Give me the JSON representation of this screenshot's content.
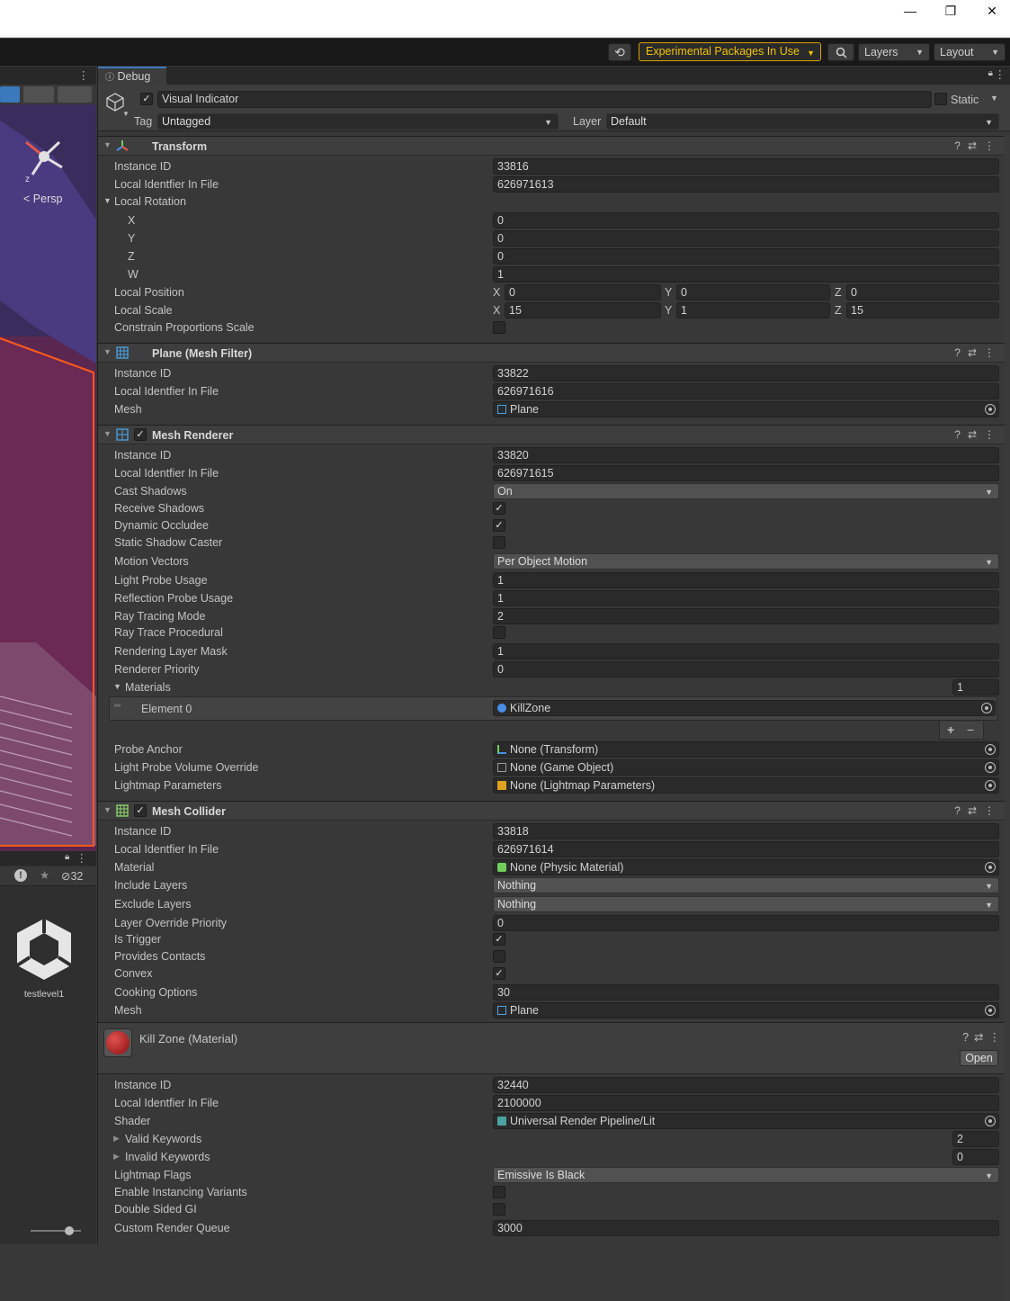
{
  "window": {
    "minimize": "—",
    "restore": "❐",
    "close": "✕"
  },
  "toolbar": {
    "experimental_label": "Experimental Packages In Use",
    "layers_label": "Layers",
    "layout_label": "Layout"
  },
  "scene": {
    "persp_label": "Persp",
    "axis_label": "z",
    "hidden_count": "32"
  },
  "project": {
    "asset_name": "testlevel1"
  },
  "inspector": {
    "tab_label": "Debug",
    "object_name": "Visual Indicator",
    "static_label": "Static",
    "tag_label": "Tag",
    "tag_value": "Untagged",
    "layer_label": "Layer",
    "layer_value": "Default",
    "transform": {
      "title": "Transform",
      "instance_id_label": "Instance ID",
      "instance_id": "33816",
      "local_id_label": "Local Identfier In File",
      "local_id": "626971613",
      "local_rotation_label": "Local Rotation",
      "x_label": "X",
      "x": "0",
      "y_label": "Y",
      "y": "0",
      "z_label": "Z",
      "z": "0",
      "w_label": "W",
      "w": "1",
      "local_position_label": "Local Position",
      "pos_x": "0",
      "pos_y": "0",
      "pos_z": "0",
      "local_scale_label": "Local Scale",
      "scale_x": "15",
      "scale_y": "1",
      "scale_z": "15",
      "constrain_label": "Constrain Proportions Scale"
    },
    "mesh_filter": {
      "title": "Plane (Mesh Filter)",
      "instance_id_label": "Instance ID",
      "instance_id": "33822",
      "local_id_label": "Local Identfier In File",
      "local_id": "626971616",
      "mesh_label": "Mesh",
      "mesh": "Plane"
    },
    "mesh_renderer": {
      "title": "Mesh Renderer",
      "instance_id_label": "Instance ID",
      "instance_id": "33820",
      "local_id_label": "Local Identfier In File",
      "local_id": "626971615",
      "cast_shadows_label": "Cast Shadows",
      "cast_shadows": "On",
      "receive_shadows_label": "Receive Shadows",
      "dynamic_occludee_label": "Dynamic Occludee",
      "static_shadow_label": "Static Shadow Caster",
      "motion_vectors_label": "Motion Vectors",
      "motion_vectors": "Per Object Motion",
      "light_probe_label": "Light Probe Usage",
      "light_probe": "1",
      "reflection_probe_label": "Reflection Probe Usage",
      "reflection_probe": "1",
      "ray_tracing_label": "Ray Tracing Mode",
      "ray_tracing": "2",
      "ray_trace_proc_label": "Ray Trace Procedural",
      "layer_mask_label": "Rendering Layer Mask",
      "layer_mask": "1",
      "priority_label": "Renderer Priority",
      "priority": "0",
      "materials_label": "Materials",
      "materials_count": "1",
      "element0_label": "Element 0",
      "element0": "KillZone",
      "add": "+",
      "remove": "−",
      "probe_anchor_label": "Probe Anchor",
      "probe_anchor": "None (Transform)",
      "lpvo_label": "Light Probe Volume Override",
      "lpvo": "None (Game Object)",
      "lightmap_params_label": "Lightmap Parameters",
      "lightmap_params": "None (Lightmap Parameters)"
    },
    "mesh_collider": {
      "title": "Mesh Collider",
      "instance_id_label": "Instance ID",
      "instance_id": "33818",
      "local_id_label": "Local Identfier In File",
      "local_id": "626971614",
      "material_label": "Material",
      "material": "None (Physic Material)",
      "include_label": "Include Layers",
      "include": "Nothing",
      "exclude_label": "Exclude Layers",
      "exclude": "Nothing",
      "override_label": "Layer Override Priority",
      "override": "0",
      "trigger_label": "Is Trigger",
      "contacts_label": "Provides Contacts",
      "convex_label": "Convex",
      "cooking_label": "Cooking Options",
      "cooking": "30",
      "mesh_label": "Mesh",
      "mesh": "Plane"
    },
    "material": {
      "title": "Kill Zone (Material)",
      "open_label": "Open",
      "instance_id_label": "Instance ID",
      "instance_id": "32440",
      "local_id_label": "Local Identfier In File",
      "local_id": "2100000",
      "shader_label": "Shader",
      "shader": "Universal Render Pipeline/Lit",
      "valid_kw_label": "Valid Keywords",
      "valid_kw": "2",
      "invalid_kw_label": "Invalid Keywords",
      "invalid_kw": "0",
      "lightmap_flags_label": "Lightmap Flags",
      "lightmap_flags": "Emissive Is Black",
      "instancing_label": "Enable Instancing Variants",
      "double_gi_label": "Double Sided GI",
      "render_queue_label": "Custom Render Queue",
      "render_queue": "3000"
    }
  },
  "colors": {
    "accent": "#3a79bb",
    "warning": "#f1c400",
    "scene_bg": "#5a2750",
    "scene_edge": "#ff5a1a"
  }
}
